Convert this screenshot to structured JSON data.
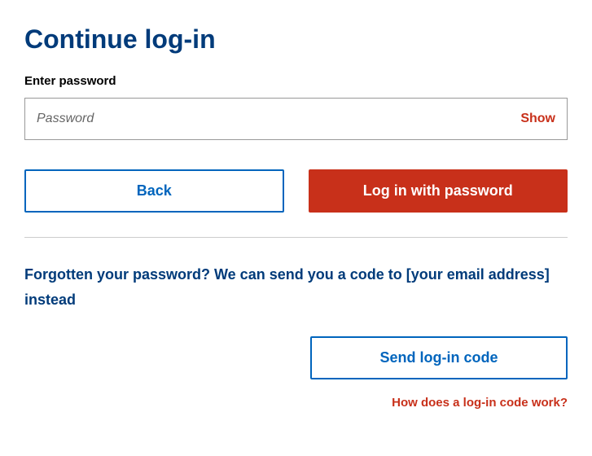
{
  "page": {
    "title": "Continue log-in"
  },
  "password_field": {
    "label": "Enter password",
    "placeholder": "Password",
    "show_toggle": "Show"
  },
  "buttons": {
    "back": "Back",
    "login_password": "Log in with password",
    "send_code": "Send log-in code"
  },
  "forgot": {
    "text": "Forgotten your password? We can send you a code to [your email address] instead"
  },
  "help": {
    "link": "How does a log-in code work?"
  }
}
